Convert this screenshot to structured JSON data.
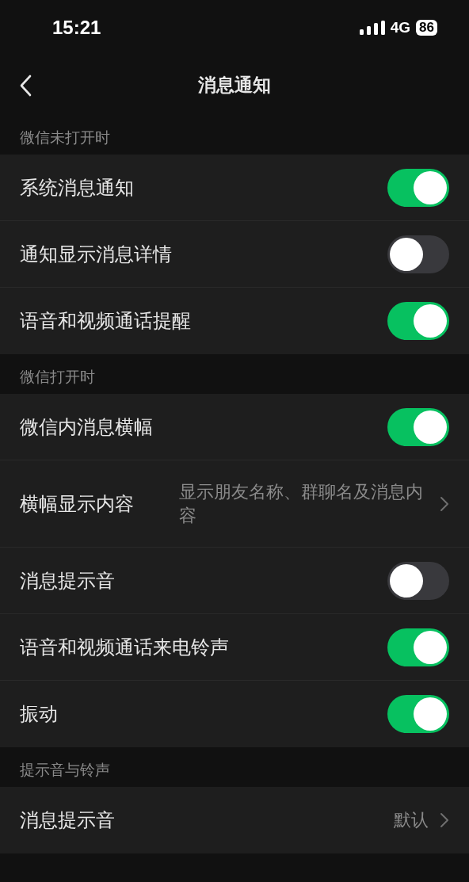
{
  "status_bar": {
    "time": "15:21",
    "network": "4G",
    "battery": "86"
  },
  "nav": {
    "title": "消息通知"
  },
  "sections": [
    {
      "header": "微信未打开时",
      "rows": [
        {
          "kind": "toggle",
          "label": "系统消息通知",
          "on": true
        },
        {
          "kind": "toggle",
          "label": "通知显示消息详情",
          "on": false
        },
        {
          "kind": "toggle",
          "label": "语音和视频通话提醒",
          "on": true
        }
      ]
    },
    {
      "header": "微信打开时",
      "rows": [
        {
          "kind": "toggle",
          "label": "微信内消息横幅",
          "on": true
        },
        {
          "kind": "link",
          "label": "横幅显示内容",
          "value": "显示朋友名称、群聊名及消息内容"
        },
        {
          "kind": "toggle",
          "label": "消息提示音",
          "on": false
        },
        {
          "kind": "toggle",
          "label": "语音和视频通话来电铃声",
          "on": true
        },
        {
          "kind": "toggle",
          "label": "振动",
          "on": true
        }
      ]
    },
    {
      "header": "提示音与铃声",
      "rows": [
        {
          "kind": "link",
          "label": "消息提示音",
          "value": "默认"
        }
      ]
    }
  ]
}
